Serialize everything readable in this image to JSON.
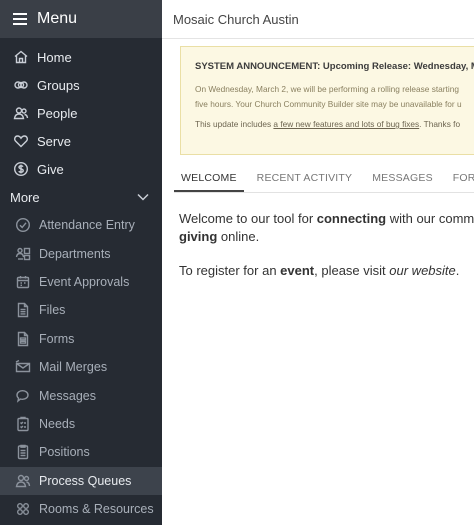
{
  "sidebar": {
    "menu_label": "Menu",
    "primary": [
      {
        "label": "Home",
        "icon": "home-icon"
      },
      {
        "label": "Groups",
        "icon": "groups-icon"
      },
      {
        "label": "People",
        "icon": "people-icon"
      },
      {
        "label": "Serve",
        "icon": "heart-icon"
      },
      {
        "label": "Give",
        "icon": "dollar-icon"
      }
    ],
    "more_label": "More",
    "secondary": [
      {
        "label": "Attendance Entry",
        "icon": "check-circle-icon"
      },
      {
        "label": "Departments",
        "icon": "departments-icon"
      },
      {
        "label": "Event Approvals",
        "icon": "calendar-icon"
      },
      {
        "label": "Files",
        "icon": "file-icon"
      },
      {
        "label": "Forms",
        "icon": "form-icon"
      },
      {
        "label": "Mail Merges",
        "icon": "mail-merge-icon"
      },
      {
        "label": "Messages",
        "icon": "chat-icon"
      },
      {
        "label": "Needs",
        "icon": "needs-icon"
      },
      {
        "label": "Positions",
        "icon": "positions-icon"
      },
      {
        "label": "Process Queues",
        "icon": "process-queues-icon"
      },
      {
        "label": "Rooms & Resources",
        "icon": "rooms-icon"
      }
    ],
    "active_item": "Process Queues"
  },
  "header": {
    "title": "Mosaic Church Austin"
  },
  "announcement": {
    "title": "SYSTEM ANNOUNCEMENT: Upcoming Release: Wednesday, March",
    "line1": "On Wednesday, March 2, we will be performing a rolling release starting",
    "line2": "five hours. Your Church Community Builder site may be unavailable for u",
    "line3_prefix": "This update includes ",
    "line3_link": "a few new features and lots of bug fixes",
    "line3_suffix": ". Thanks fo"
  },
  "tabs": [
    {
      "label": "WELCOME",
      "active": true
    },
    {
      "label": "RECENT ACTIVITY",
      "active": false
    },
    {
      "label": "MESSAGES",
      "active": false
    },
    {
      "label": "FORMS",
      "active": false
    }
  ],
  "content": {
    "p1_a": "Welcome to our tool for ",
    "p1_b": "connecting",
    "p1_c": " with our commu",
    "p1_d": "giving",
    "p1_e": " online.",
    "p2_a": "To register for an ",
    "p2_b": "event",
    "p2_c": ", please visit ",
    "p2_d": "our website",
    "p2_e": "."
  }
}
